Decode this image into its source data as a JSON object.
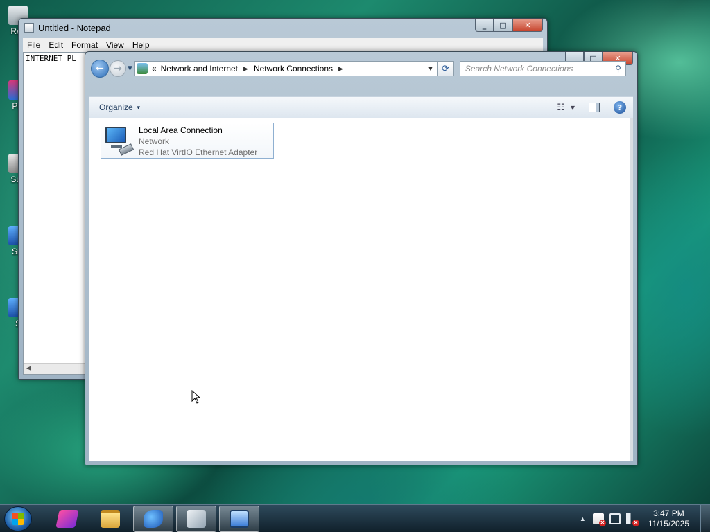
{
  "desktop": {
    "icons": [
      {
        "label": "Rec"
      },
      {
        "label": "Pla"
      },
      {
        "label": "Sup"
      },
      {
        "label": "Sm"
      },
      {
        "label": "S"
      }
    ]
  },
  "notepad": {
    "title": "Untitled - Notepad",
    "menu": [
      "File",
      "Edit",
      "Format",
      "View",
      "Help"
    ],
    "text": "INTERNET PL"
  },
  "explorer": {
    "breadcrumb_prefix": "«",
    "breadcrumb": [
      "Network and Internet",
      "Network Connections"
    ],
    "search_placeholder": "Search Network Connections",
    "organize_label": "Organize",
    "items": [
      {
        "name": "Local Area Connection",
        "status": "Network",
        "device": "Red Hat VirtIO Ethernet Adapter"
      }
    ]
  },
  "taskbar": {
    "time": "3:47 PM",
    "date": "11/15/2025"
  },
  "colors": {
    "selection_border": "#8fb0d1",
    "subtext": "#6d6d6d",
    "search_placeholder": "#8a8a8a"
  },
  "icons": {
    "back": "back-arrow-icon",
    "forward": "forward-arrow-icon",
    "refresh": "refresh-icon",
    "search": "magnifier-icon",
    "help": "help-icon"
  }
}
